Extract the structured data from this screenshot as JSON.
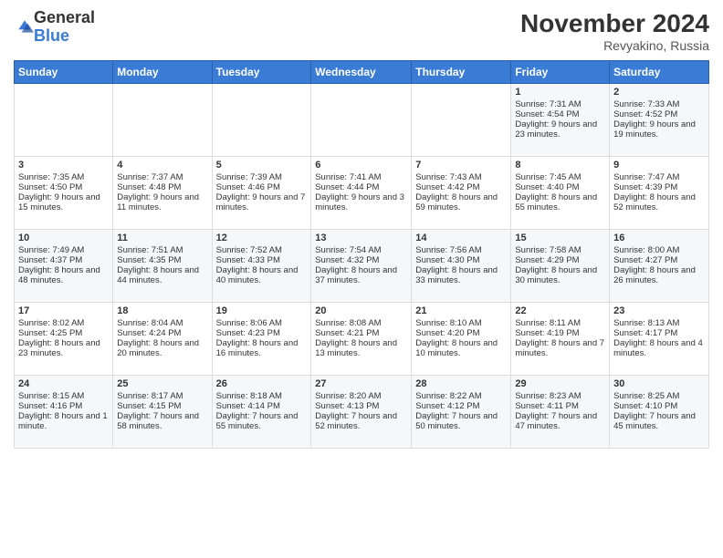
{
  "logo": {
    "general": "General",
    "blue": "Blue"
  },
  "title": "November 2024",
  "location": "Revyakino, Russia",
  "days_of_week": [
    "Sunday",
    "Monday",
    "Tuesday",
    "Wednesday",
    "Thursday",
    "Friday",
    "Saturday"
  ],
  "weeks": [
    [
      {
        "day": "",
        "info": ""
      },
      {
        "day": "",
        "info": ""
      },
      {
        "day": "",
        "info": ""
      },
      {
        "day": "",
        "info": ""
      },
      {
        "day": "",
        "info": ""
      },
      {
        "day": "1",
        "info": "Sunrise: 7:31 AM\nSunset: 4:54 PM\nDaylight: 9 hours and 23 minutes."
      },
      {
        "day": "2",
        "info": "Sunrise: 7:33 AM\nSunset: 4:52 PM\nDaylight: 9 hours and 19 minutes."
      }
    ],
    [
      {
        "day": "3",
        "info": "Sunrise: 7:35 AM\nSunset: 4:50 PM\nDaylight: 9 hours and 15 minutes."
      },
      {
        "day": "4",
        "info": "Sunrise: 7:37 AM\nSunset: 4:48 PM\nDaylight: 9 hours and 11 minutes."
      },
      {
        "day": "5",
        "info": "Sunrise: 7:39 AM\nSunset: 4:46 PM\nDaylight: 9 hours and 7 minutes."
      },
      {
        "day": "6",
        "info": "Sunrise: 7:41 AM\nSunset: 4:44 PM\nDaylight: 9 hours and 3 minutes."
      },
      {
        "day": "7",
        "info": "Sunrise: 7:43 AM\nSunset: 4:42 PM\nDaylight: 8 hours and 59 minutes."
      },
      {
        "day": "8",
        "info": "Sunrise: 7:45 AM\nSunset: 4:40 PM\nDaylight: 8 hours and 55 minutes."
      },
      {
        "day": "9",
        "info": "Sunrise: 7:47 AM\nSunset: 4:39 PM\nDaylight: 8 hours and 52 minutes."
      }
    ],
    [
      {
        "day": "10",
        "info": "Sunrise: 7:49 AM\nSunset: 4:37 PM\nDaylight: 8 hours and 48 minutes."
      },
      {
        "day": "11",
        "info": "Sunrise: 7:51 AM\nSunset: 4:35 PM\nDaylight: 8 hours and 44 minutes."
      },
      {
        "day": "12",
        "info": "Sunrise: 7:52 AM\nSunset: 4:33 PM\nDaylight: 8 hours and 40 minutes."
      },
      {
        "day": "13",
        "info": "Sunrise: 7:54 AM\nSunset: 4:32 PM\nDaylight: 8 hours and 37 minutes."
      },
      {
        "day": "14",
        "info": "Sunrise: 7:56 AM\nSunset: 4:30 PM\nDaylight: 8 hours and 33 minutes."
      },
      {
        "day": "15",
        "info": "Sunrise: 7:58 AM\nSunset: 4:29 PM\nDaylight: 8 hours and 30 minutes."
      },
      {
        "day": "16",
        "info": "Sunrise: 8:00 AM\nSunset: 4:27 PM\nDaylight: 8 hours and 26 minutes."
      }
    ],
    [
      {
        "day": "17",
        "info": "Sunrise: 8:02 AM\nSunset: 4:25 PM\nDaylight: 8 hours and 23 minutes."
      },
      {
        "day": "18",
        "info": "Sunrise: 8:04 AM\nSunset: 4:24 PM\nDaylight: 8 hours and 20 minutes."
      },
      {
        "day": "19",
        "info": "Sunrise: 8:06 AM\nSunset: 4:23 PM\nDaylight: 8 hours and 16 minutes."
      },
      {
        "day": "20",
        "info": "Sunrise: 8:08 AM\nSunset: 4:21 PM\nDaylight: 8 hours and 13 minutes."
      },
      {
        "day": "21",
        "info": "Sunrise: 8:10 AM\nSunset: 4:20 PM\nDaylight: 8 hours and 10 minutes."
      },
      {
        "day": "22",
        "info": "Sunrise: 8:11 AM\nSunset: 4:19 PM\nDaylight: 8 hours and 7 minutes."
      },
      {
        "day": "23",
        "info": "Sunrise: 8:13 AM\nSunset: 4:17 PM\nDaylight: 8 hours and 4 minutes."
      }
    ],
    [
      {
        "day": "24",
        "info": "Sunrise: 8:15 AM\nSunset: 4:16 PM\nDaylight: 8 hours and 1 minute."
      },
      {
        "day": "25",
        "info": "Sunrise: 8:17 AM\nSunset: 4:15 PM\nDaylight: 7 hours and 58 minutes."
      },
      {
        "day": "26",
        "info": "Sunrise: 8:18 AM\nSunset: 4:14 PM\nDaylight: 7 hours and 55 minutes."
      },
      {
        "day": "27",
        "info": "Sunrise: 8:20 AM\nSunset: 4:13 PM\nDaylight: 7 hours and 52 minutes."
      },
      {
        "day": "28",
        "info": "Sunrise: 8:22 AM\nSunset: 4:12 PM\nDaylight: 7 hours and 50 minutes."
      },
      {
        "day": "29",
        "info": "Sunrise: 8:23 AM\nSunset: 4:11 PM\nDaylight: 7 hours and 47 minutes."
      },
      {
        "day": "30",
        "info": "Sunrise: 8:25 AM\nSunset: 4:10 PM\nDaylight: 7 hours and 45 minutes."
      }
    ]
  ]
}
